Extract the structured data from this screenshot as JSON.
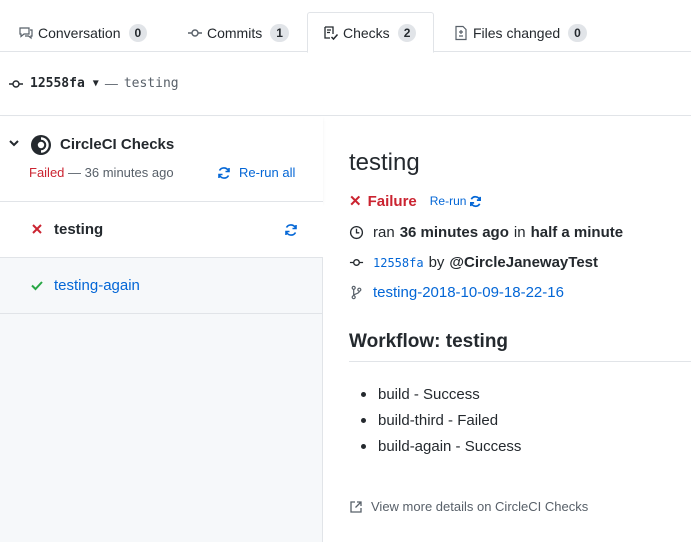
{
  "tabs": [
    {
      "label": "Conversation",
      "count": "0",
      "icon": "conversation-icon"
    },
    {
      "label": "Commits",
      "count": "1",
      "icon": "commit-icon"
    },
    {
      "label": "Checks",
      "count": "2",
      "icon": "checklist-icon",
      "active": true
    },
    {
      "label": "Files changed",
      "count": "0",
      "icon": "file-diff-icon"
    }
  ],
  "commit_bar": {
    "sha": "12558fa",
    "separator": "—",
    "name": "testing"
  },
  "suite": {
    "title": "CircleCI Checks",
    "status": "Failed",
    "time": "— 36 minutes ago",
    "rerun_all": "Re-run all"
  },
  "runs": [
    {
      "label": "testing",
      "state": "failure"
    },
    {
      "label": "testing-again",
      "state": "success"
    }
  ],
  "detail": {
    "title": "testing",
    "status": "Failure",
    "rerun": "Re-run",
    "ran_prefix": "ran",
    "ran_time": "36 minutes ago",
    "ran_in": "in",
    "ran_duration": "half a minute",
    "commit_sha": "12558fa",
    "commit_by": "by",
    "commit_author": "@CircleJanewayTest",
    "branch": "testing-2018-10-09-18-22-16",
    "workflow_heading": "Workflow: testing",
    "jobs": [
      "build - Success",
      "build-third - Failed",
      "build-again - Success"
    ],
    "more_link": "View more details on CircleCI Checks"
  },
  "colors": {
    "accent": "#0366d6",
    "failure": "#cb2431",
    "success": "#28a745",
    "muted": "#586069"
  }
}
